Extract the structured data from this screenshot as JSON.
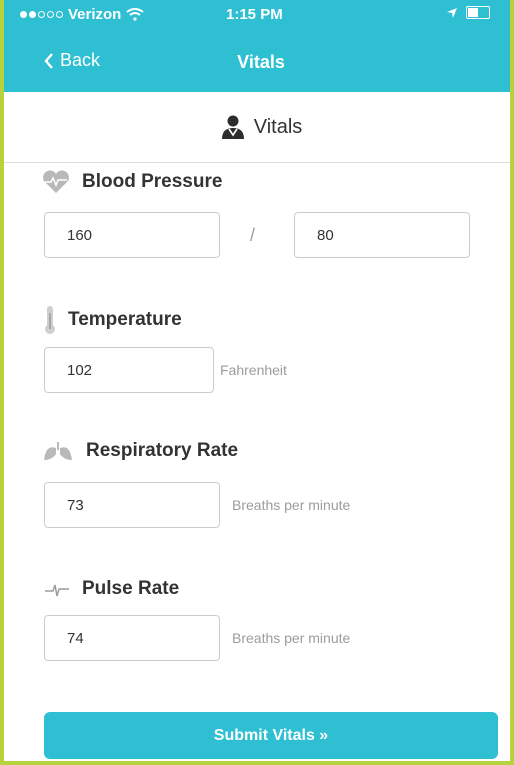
{
  "status": {
    "carrier": "Verizon",
    "time": "1:15 PM"
  },
  "nav": {
    "back_label": "Back",
    "title": "Vitals"
  },
  "section": {
    "title": "Vitals"
  },
  "blood_pressure": {
    "label": "Blood Pressure",
    "systolic": "160",
    "separator": "/",
    "diastolic": "80"
  },
  "temperature": {
    "label": "Temperature",
    "value": "102",
    "unit": "Fahrenheit"
  },
  "respiratory_rate": {
    "label": "Respiratory Rate",
    "value": "73",
    "unit": "Breaths per minute"
  },
  "pulse_rate": {
    "label": "Pulse Rate",
    "value": "74",
    "unit": "Breaths per minute"
  },
  "submit": {
    "label": "Submit Vitals »"
  },
  "colors": {
    "accent": "#2ebfd3",
    "border": "#b6d23c",
    "icon": "#b9b9b9"
  }
}
